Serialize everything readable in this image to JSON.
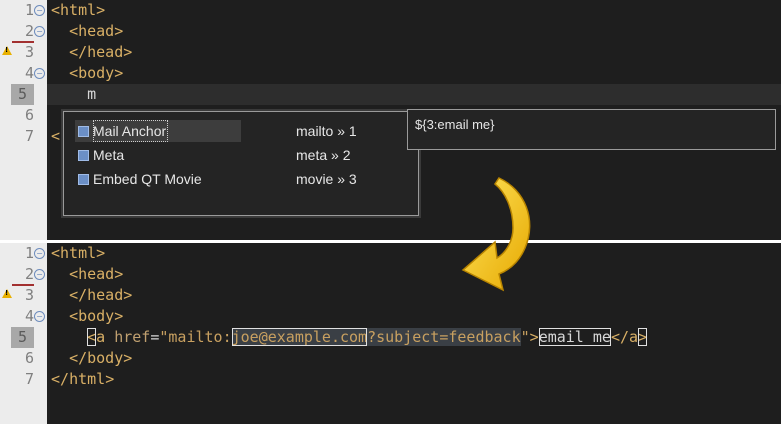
{
  "top_editor": {
    "line_numbers": [
      "1",
      "2",
      "3",
      "4",
      "5",
      "6",
      "7"
    ],
    "lines": [
      {
        "open": "<",
        "name": "html",
        "close": ">"
      },
      {
        "open": "<",
        "name": "head",
        "close": ">"
      },
      {
        "open": "</",
        "name": "head",
        "close": ">"
      },
      {
        "open": "<",
        "name": "body",
        "close": ">"
      },
      {
        "text": "m"
      },
      {
        "text": ""
      },
      {
        "text": "<"
      }
    ]
  },
  "completion_popup": {
    "items": [
      {
        "label": "Mail Anchor",
        "trigger": "mailto » 1",
        "selected": true
      },
      {
        "label": "Meta",
        "trigger": "meta » 2",
        "selected": false
      },
      {
        "label": "Embed QT Movie",
        "trigger": "movie » 3",
        "selected": false
      }
    ],
    "info_text": "${3:email me}"
  },
  "bottom_editor": {
    "line_numbers": [
      "1",
      "2",
      "3",
      "4",
      "5",
      "6",
      "7"
    ],
    "html_open": {
      "open": "<",
      "name": "html",
      "close": ">"
    },
    "head_open": {
      "open": "<",
      "name": "head",
      "close": ">"
    },
    "head_close": {
      "open": "</",
      "name": "head",
      "close": ">"
    },
    "body_open": {
      "open": "<",
      "name": "body",
      "close": ">"
    },
    "anchor": {
      "open": "<",
      "tag": "a",
      "attr": "href",
      "eq": "=",
      "quote": "\"",
      "scheme": "mailto:",
      "email": "joe@example.com",
      "query": "?subject=feedback",
      "end_quote": "\"",
      "gt": ">",
      "text": "email me",
      "close_open": "</",
      "close_tag": "a",
      "close_gt": ">"
    },
    "body_close": {
      "open": "</",
      "name": "body",
      "close": ">"
    },
    "html_close": {
      "open": "</",
      "name": "html",
      "close": ">"
    }
  },
  "colors": {
    "tag": "#d9b066",
    "arrow": "#f2c200",
    "gutter": "#ececec",
    "editor_bg": "#1e1e1e"
  },
  "icons": [
    "fold-icon",
    "warning-icon",
    "template-icon",
    "arrow-icon"
  ]
}
